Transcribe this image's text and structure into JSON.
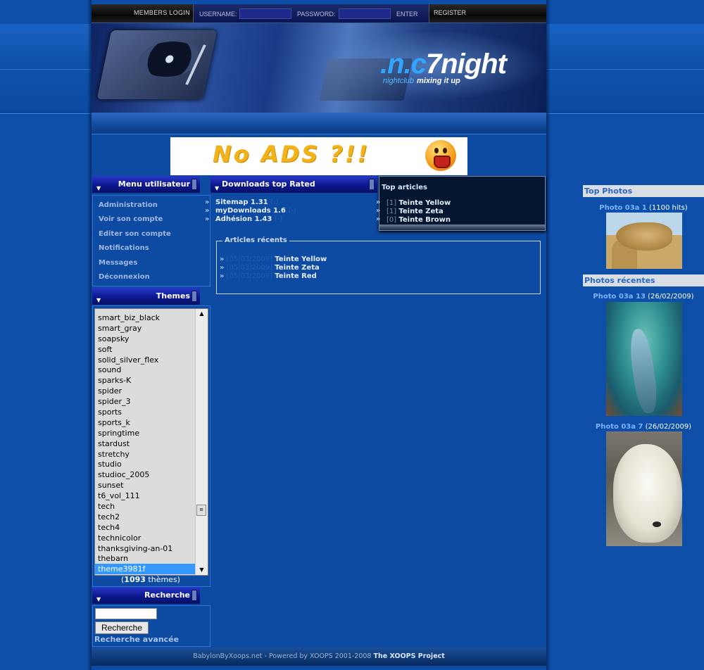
{
  "colors": {
    "page_bg": "#0c4ea8",
    "block_title": "#0c1890",
    "accent_link": "#7fb2ff",
    "selection": "#3399ff"
  },
  "login_bar": {
    "members_login": "MEMBERS LOGIN",
    "username_label": "USERNAME:",
    "password_label": "PASSWORD:",
    "enter": "ENTER",
    "register": "REGISTER"
  },
  "header": {
    "logo_part1": ".n.c",
    "logo_part2": "7night",
    "tagline_1": "nightclub",
    "tagline_2": "mixing it up"
  },
  "banner": {
    "text": "No ADS ?!!",
    "icon": "shocked-smiley-icon"
  },
  "user_menu": {
    "title": "Menu utilisateur",
    "items": [
      "Administration",
      "Voir son compte",
      "Editer son compte",
      "Notifications",
      "Messages",
      "Déconnexion"
    ]
  },
  "themes": {
    "title": "Themes",
    "options": [
      "smart_biz_black",
      "smart_gray",
      "soapsky",
      "soft",
      "solid_silver_flex",
      "sound",
      "sparks-K",
      "spider",
      "spider_3",
      "sports",
      "sports_k",
      "springtime",
      "stardust",
      "stretchy",
      "studio",
      "studioc_2005",
      "sunset",
      "t6_vol_111",
      "tech",
      "tech2",
      "tech4",
      "technicolor",
      "thanksgiving-an-01",
      "thebarn",
      "theme3981f"
    ],
    "selected": "theme3981f",
    "count": "1093",
    "count_suffix": " thèmes)",
    "count_prefix": "("
  },
  "search": {
    "title": "Recherche",
    "button": "Recherche",
    "advanced": "Recherche avancée"
  },
  "downloads": {
    "title": "Downloads top Rated",
    "items": [
      {
        "name": "Sitemap 1.31",
        "count": "(-)"
      },
      {
        "name": "myDownloads 1.6",
        "count": "(-)"
      },
      {
        "name": "Adhésion 1.43",
        "count": "(-)"
      }
    ]
  },
  "top_articles": {
    "title": "Top articles",
    "items": [
      {
        "hits": "[1]",
        "title": "Teinte Yellow"
      },
      {
        "hits": "[1]",
        "title": "Teinte Zeta"
      },
      {
        "hits": "[0]",
        "title": "Teinte Brown"
      }
    ]
  },
  "recent_articles": {
    "title": "Articles récents",
    "items": [
      {
        "date": "[05/03/2009]",
        "title": "Teinte Yellow"
      },
      {
        "date": "[05/03/2009]",
        "title": "Teinte Zeta"
      },
      {
        "date": "[05/03/2009]",
        "title": "Teinte Red"
      }
    ]
  },
  "right_column": {
    "top_photos_title": "Top Photos",
    "top_photo": {
      "name": "Photo 03a 1",
      "meta": "(1100 hits)"
    },
    "recent_photos_title": "Photos récentes",
    "recent_photos": [
      {
        "name": "Photo 03a 13",
        "meta": "(26/02/2009)"
      },
      {
        "name": "Photo 03a 7",
        "meta": "(26/02/2009)"
      }
    ]
  },
  "footer": {
    "text": "BabylonByXoops.net - Powered by XOOPS 2001-2008",
    "link": "The XOOPS Project"
  }
}
